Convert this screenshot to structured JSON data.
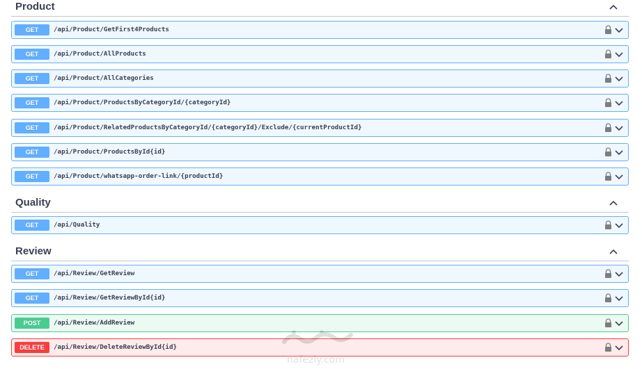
{
  "colors": {
    "get": "#61affe",
    "post": "#49cc90",
    "delete": "#f93e3e",
    "text": "#3b4151"
  },
  "sections": {
    "product": {
      "title": "Product",
      "toggle_icon": "chevron-up-icon",
      "operations": [
        {
          "method": "GET",
          "path": "/api/Product/GetFirst4Products"
        },
        {
          "method": "GET",
          "path": "/api/Product/AllProducts"
        },
        {
          "method": "GET",
          "path": "/api/Product/AllCategories"
        },
        {
          "method": "GET",
          "path": "/api/Product/ProductsByCategoryId/{categoryId}"
        },
        {
          "method": "GET",
          "path": "/api/Product/RelatedProductsByCategoryId/{categoryId}/Exclude/{currentProductId}"
        },
        {
          "method": "GET",
          "path": "/api/Product/ProductsById{id}"
        },
        {
          "method": "GET",
          "path": "/api/Product/whatsapp-order-link/{productId}"
        }
      ]
    },
    "quality": {
      "title": "Quality",
      "toggle_icon": "chevron-up-icon",
      "operations": [
        {
          "method": "GET",
          "path": "/api/Quality"
        }
      ]
    },
    "review": {
      "title": "Review",
      "toggle_icon": "chevron-up-icon",
      "operations": [
        {
          "method": "GET",
          "path": "/api/Review/GetReview"
        },
        {
          "method": "GET",
          "path": "/api/Review/GetReviewById{id}"
        },
        {
          "method": "POST",
          "path": "/api/Review/AddReview"
        },
        {
          "method": "DELETE",
          "path": "/api/Review/DeleteReviewById{id}"
        }
      ]
    }
  },
  "watermark": {
    "icon": "watermark-logo-icon",
    "text": "nafezly.com"
  }
}
